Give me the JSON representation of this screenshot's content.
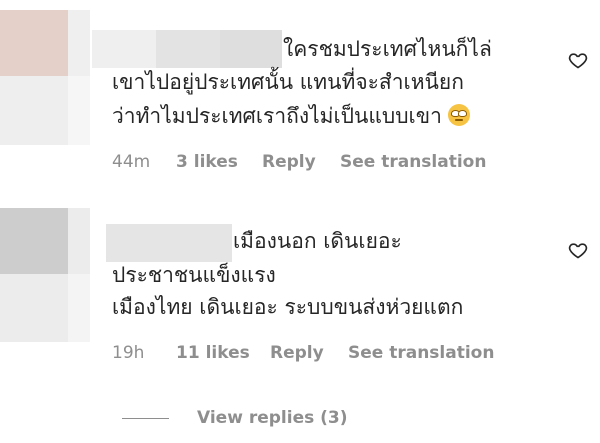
{
  "comments": [
    {
      "avatar_tiles": [
        "#e4cfc9",
        "#efefef",
        "#eeeeee",
        "#f6f6f6"
      ],
      "username_tiles": [
        "#efefef",
        "#e3e3e3",
        "#dedede"
      ],
      "lines": [
        "ใครชมประเทศไหนก็ไล่",
        "เขาไปอยู่ประเทศนั้น แทนที่จะสำเหนียก",
        "ว่าทำไมประเทศเราถึงไม่เป็นแบบเขา"
      ],
      "emoji": "rolling-eyes-emoji",
      "time": "44m",
      "likes": "3 likes",
      "reply": "Reply",
      "translate": "See translation"
    },
    {
      "avatar_tiles": [
        "#cdcdcd",
        "#ececec",
        "#ececec",
        "#f4f4f4"
      ],
      "username_tiles": [
        "#e5e5e5"
      ],
      "lines": [
        "เมืองนอก เดินเยอะ",
        "ประชาชนแข็งแรง",
        "เมืองไทย เดินเยอะ ระบบขนส่งห่วยแตก"
      ],
      "time": "19h",
      "likes": "11 likes",
      "reply": "Reply",
      "translate": "See translation"
    }
  ],
  "view_replies": "View replies (3)",
  "icons": {
    "like": "heart-icon"
  }
}
